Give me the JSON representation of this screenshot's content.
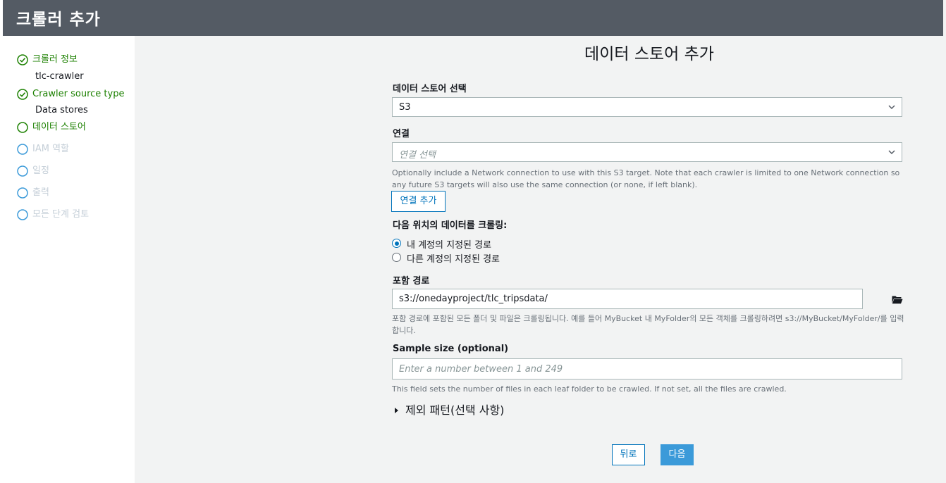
{
  "header": {
    "title": "크롤러 추가"
  },
  "sidebar": {
    "steps": [
      {
        "label": "크롤러 정보",
        "sub": "tlc-crawler",
        "state": "done"
      },
      {
        "label": "Crawler source type",
        "sub": "Data stores",
        "state": "done"
      },
      {
        "label": "데이터 스토어",
        "state": "current"
      },
      {
        "label": "IAM 역할",
        "state": "todo"
      },
      {
        "label": "일정",
        "state": "todo"
      },
      {
        "label": "출력",
        "state": "todo"
      },
      {
        "label": "모든 단계 검토",
        "state": "todo"
      }
    ]
  },
  "main": {
    "title": "데이터 스토어 추가",
    "datastore": {
      "label": "데이터 스토어 선택",
      "value": "S3"
    },
    "connection": {
      "label": "연결",
      "placeholder": "연결 선택",
      "help": "Optionally include a Network connection to use with this S3 target. Note that each crawler is limited to one Network connection so any future S3 targets will also use the same connection (or none, if left blank).",
      "add_button": "연결 추가"
    },
    "crawl": {
      "label": "다음 위치의 데이터를 크롤링:",
      "options": [
        "내 계정의 지정된 경로",
        "다른 계정의 지정된 경로"
      ],
      "selected": 0
    },
    "include_path": {
      "label": "포함 경로",
      "value": "s3://onedayproject/tlc_tripsdata/",
      "help": "포함 경로에 포함된 모든 폴더 및 파일은 크롤링됩니다. 예를 들어 MyBucket 내 MyFolder의 모든 객체를 크롤링하려면 s3://MyBucket/MyFolder/를 입력합니다."
    },
    "sample_size": {
      "label": "Sample size (optional)",
      "placeholder": "Enter a number between 1 and 249",
      "help": "This field sets the number of files in each leaf folder to be crawled. If not set, all the files are crawled."
    },
    "exclude": {
      "label": "제외 패턴(선택 사항)"
    },
    "buttons": {
      "back": "뒤로",
      "next": "다음"
    }
  },
  "colors": {
    "header_bg": "#545b64",
    "done_green": "#1d8102",
    "todo_gray": "#c5cfd8",
    "accent_blue": "#0073bb",
    "primary_button": "#3b9ad9"
  }
}
